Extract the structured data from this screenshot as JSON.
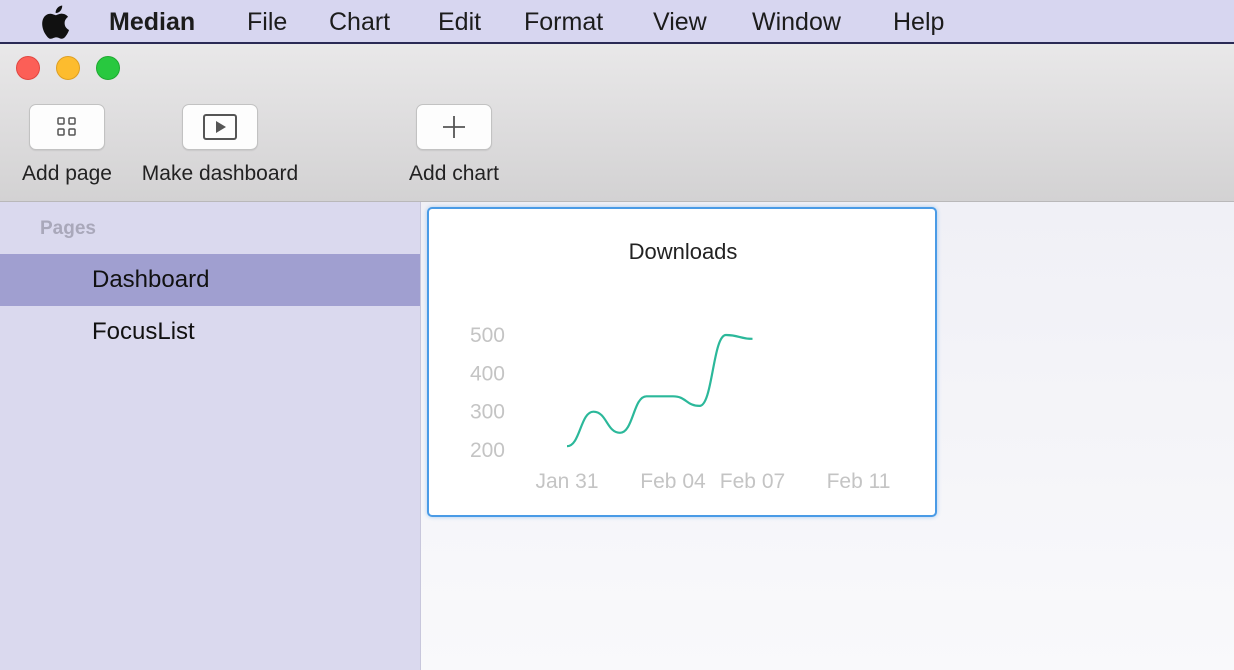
{
  "menu_bar": {
    "app_name": "Median",
    "items": [
      "File",
      "Chart",
      "Edit",
      "Format",
      "View",
      "Window",
      "Help"
    ]
  },
  "window_controls": [
    "close",
    "minimize",
    "zoom"
  ],
  "toolbar": {
    "buttons": [
      {
        "label": "Add page",
        "icon": "grid-icon"
      },
      {
        "label": "Make dashboard",
        "icon": "play-icon"
      },
      {
        "label": "Add chart",
        "icon": "plus-icon"
      }
    ]
  },
  "sidebar": {
    "heading": "Pages",
    "items": [
      {
        "label": "Dashboard",
        "selected": true
      },
      {
        "label": "FocusList",
        "selected": false
      }
    ]
  },
  "colors": {
    "menubar_bg": "#d7d6f0",
    "sidebar_bg": "#dad9ee",
    "selected_item_bg": "#a09fd0",
    "card_border": "#4a9be6",
    "line_color": "#2bb89a"
  },
  "chart_data": {
    "type": "line",
    "title": "Downloads",
    "xlabel": "",
    "ylabel": "",
    "x_tick_labels": [
      "Jan 31",
      "Feb 04",
      "Feb 07",
      "Feb 11"
    ],
    "y_tick_labels": [
      "500",
      "400",
      "300",
      "200"
    ],
    "x_range": [
      "2016-01-31",
      "2016-02-12"
    ],
    "ylim": [
      200,
      500
    ],
    "grid": false,
    "legend": "none",
    "series": [
      {
        "values": [
          {
            "x": "2016-01-31",
            "y": 210
          },
          {
            "x": "2016-02-01",
            "y": 300
          },
          {
            "x": "2016-02-02",
            "y": 245
          },
          {
            "x": "2016-02-03",
            "y": 340
          },
          {
            "x": "2016-02-04",
            "y": 340
          },
          {
            "x": "2016-02-05",
            "y": 315
          },
          {
            "x": "2016-02-06",
            "y": 500
          },
          {
            "x": "2016-02-07",
            "y": 490
          }
        ]
      }
    ]
  }
}
